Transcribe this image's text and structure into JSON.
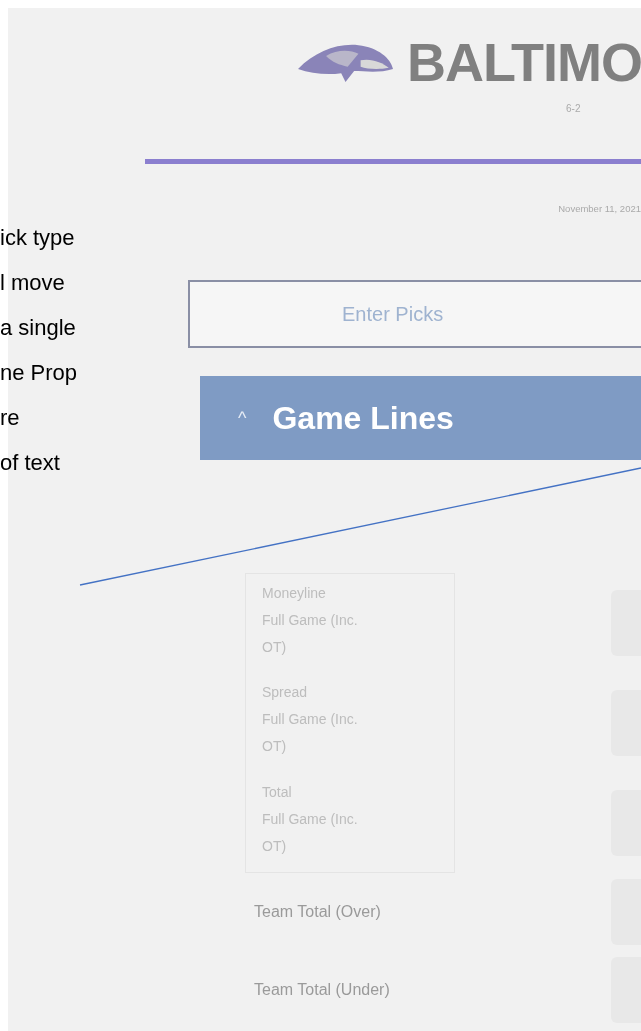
{
  "annotation": {
    "lines": [
      "ick type",
      "l move",
      "a single",
      "ne Prop",
      "re",
      "of text"
    ]
  },
  "header": {
    "team": "BALTIMO",
    "record": "6-2",
    "date": "November 11, 2021"
  },
  "enter_picks": {
    "label": "Enter Picks"
  },
  "section": {
    "caret": "^",
    "title": "Game Lines"
  },
  "picks": [
    {
      "kind": "grouped",
      "label": "Moneyline",
      "sublabel": "Full Game (Inc. OT)"
    },
    {
      "kind": "grouped",
      "label": "Spread",
      "sublabel": "Full Game (Inc. OT)"
    },
    {
      "kind": "grouped",
      "label": "Total",
      "sublabel": "Full Game (Inc. OT)"
    },
    {
      "kind": "single",
      "label": "Team Total (Over)"
    },
    {
      "kind": "single",
      "label": "Team Total (Under)"
    }
  ]
}
